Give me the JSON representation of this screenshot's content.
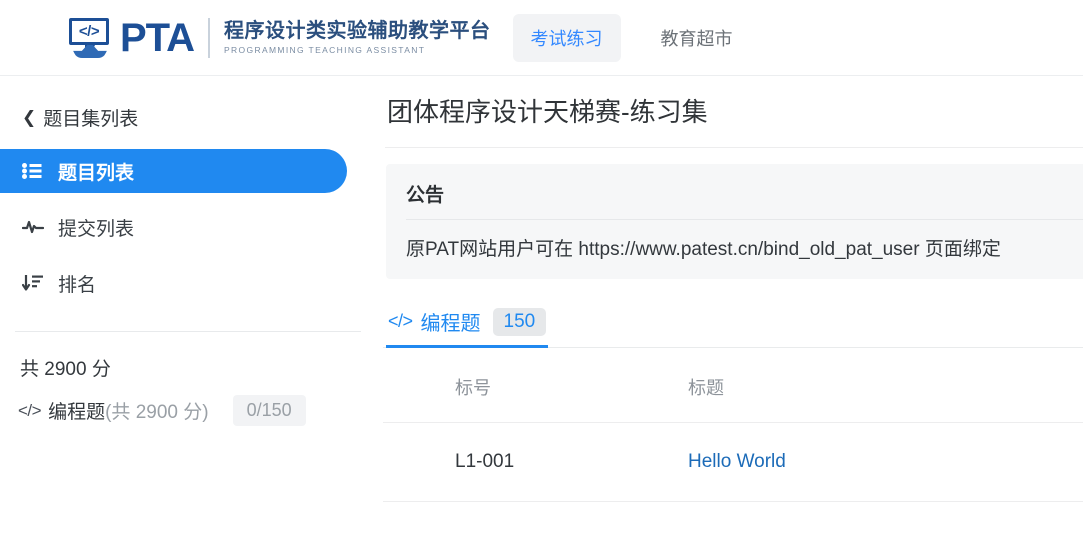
{
  "header": {
    "logo": {
      "icon": "code-bubble-icon",
      "code_glyph": "</>",
      "wordmark": "PTA",
      "subtitle_cn": "程序设计类实验辅助教学平台",
      "subtitle_en": "PROGRAMMING TEACHING ASSISTANT"
    },
    "nav": [
      {
        "label": "考试练习",
        "active": true
      },
      {
        "label": "教育超市",
        "active": false
      }
    ]
  },
  "sidebar": {
    "back": {
      "label": "题目集列表",
      "icon": "chevron-left-icon"
    },
    "items": [
      {
        "label": "题目列表",
        "icon": "list-icon",
        "active": true
      },
      {
        "label": "提交列表",
        "icon": "activity-icon",
        "active": false
      },
      {
        "label": "排名",
        "icon": "sort-descending-icon",
        "active": false
      }
    ],
    "score": {
      "total_label": "共 2900 分",
      "type_icon": "code-icon",
      "type_label": "编程题",
      "type_points": "(共 2900 分)",
      "progress_badge": "0/150"
    }
  },
  "main": {
    "title": "团体程序设计天梯赛-练习集",
    "notice": {
      "heading": "公告",
      "body": "原PAT网站用户可在 https://www.patest.cn/bind_old_pat_user 页面绑定"
    },
    "tabs": [
      {
        "icon": "code-icon",
        "code_glyph": "</>",
        "label": "编程题",
        "badge": "150",
        "active": true
      }
    ],
    "table": {
      "columns": [
        "标号",
        "标题"
      ],
      "rows": [
        {
          "id": "L1-001",
          "title": "Hello World"
        }
      ]
    }
  },
  "colors": {
    "brand_blue": "#1d4f96",
    "accent_blue": "#2089f0",
    "link_blue": "#1c6bb8",
    "muted_gray": "#9aa0a6",
    "panel_gray": "#f6f7f8"
  }
}
